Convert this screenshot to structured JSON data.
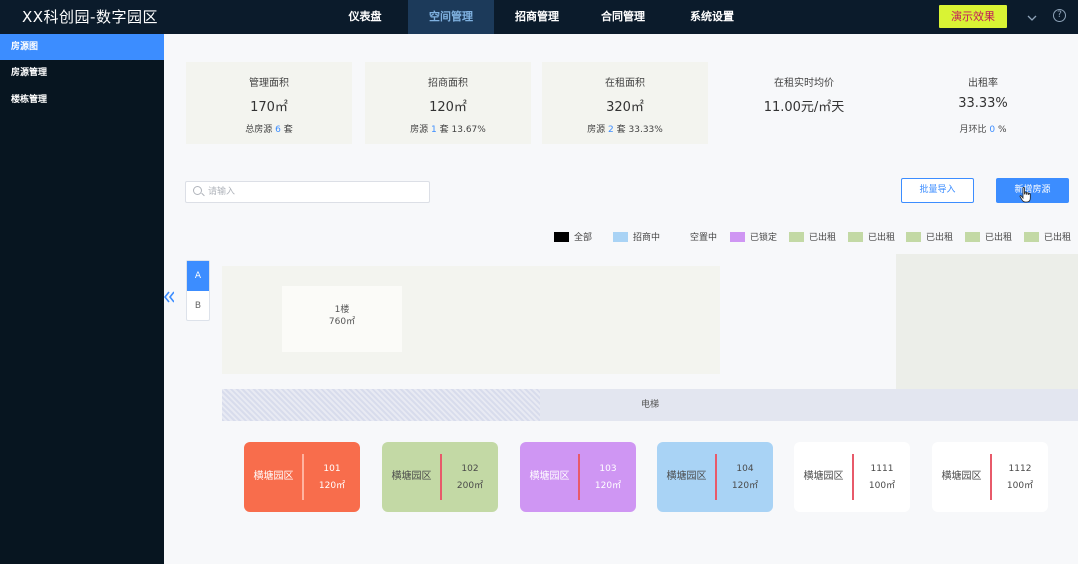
{
  "app": {
    "title": "XX科创园-数字园区"
  },
  "nav": {
    "items": [
      {
        "label": "仪表盘"
      },
      {
        "label": "空间管理"
      },
      {
        "label": "招商管理"
      },
      {
        "label": "合同管理"
      },
      {
        "label": "系统设置"
      }
    ],
    "active_index": 1
  },
  "header": {
    "demo_label": "演示效果",
    "chevron_icon": "chevron-down-icon",
    "help_icon": "help-icon",
    "help_glyph": "?"
  },
  "sidebar": {
    "items": [
      {
        "label": "房源图"
      },
      {
        "label": "房源管理"
      },
      {
        "label": "楼栋管理"
      }
    ],
    "active_index": 0
  },
  "stats": [
    {
      "label": "管理面积",
      "value": "170㎡",
      "sub_prefix": "总房源",
      "sub_num": "6",
      "sub_suffix": "套"
    },
    {
      "label": "招商面积",
      "value": "120㎡",
      "sub_prefix": "房源",
      "sub_num": "1",
      "sub_suffix": "套 13.67%"
    },
    {
      "label": "在租面积",
      "value": "320㎡",
      "sub_prefix": "房源",
      "sub_num": "2",
      "sub_suffix": "套 33.33%"
    },
    {
      "label": "在租实时均价",
      "value": "11.00元/㎡天"
    },
    {
      "label": "出租率",
      "value": "33.33%",
      "sub_prefix": "月环比",
      "sub_num": "0",
      "sub_suffix": "%"
    }
  ],
  "search": {
    "placeholder": "请输入",
    "value": ""
  },
  "actions": {
    "import_label": "批量导入",
    "new_label": "新增房源"
  },
  "legend": [
    {
      "label": "全部",
      "color": "#000000"
    },
    {
      "label": "招商中",
      "color": "#a9d3f5"
    },
    {
      "label": "空置中",
      "color": ""
    },
    {
      "label": "已锁定",
      "color": "#cf96f3"
    },
    {
      "label": "已出租",
      "color": "#c3d9a5"
    },
    {
      "label": "已出租",
      "color": "#c3d9a5"
    },
    {
      "label": "已出租",
      "color": "#c3d9a5"
    },
    {
      "label": "已出租",
      "color": "#c3d9a5"
    },
    {
      "label": "已出租",
      "color": "#c3d9a5"
    }
  ],
  "buildings": [
    {
      "label": "A"
    },
    {
      "label": "B"
    }
  ],
  "active_building": 0,
  "floor": {
    "name": "1楼",
    "area": "760㎡"
  },
  "elevator": {
    "label": "电梯"
  },
  "rooms": [
    {
      "park": "横塘园区",
      "number": "101",
      "area": "120㎡",
      "bg": "#f86d4c",
      "text_color": "#ffffff",
      "bar_color": "#ffb3a0"
    },
    {
      "park": "横塘园区",
      "number": "102",
      "area": "200㎡",
      "bg": "#c3d9a5",
      "text_color": "#4a4a4a",
      "bar_color": "#e85a6a"
    },
    {
      "park": "横塘园区",
      "number": "103",
      "area": "120㎡",
      "bg": "#cf96f3",
      "text_color": "#ffffff",
      "bar_color": "#e85a6a"
    },
    {
      "park": "横塘园区",
      "number": "104",
      "area": "120㎡",
      "bg": "#a9d3f5",
      "text_color": "#4a4a4a",
      "bar_color": "#e85a6a"
    },
    {
      "park": "横塘园区",
      "number": "1111",
      "area": "100㎡",
      "bg": "#ffffff",
      "text_color": "#4a4a4a",
      "bar_color": "#e85a6a"
    },
    {
      "park": "横塘园区",
      "number": "1112",
      "area": "100㎡",
      "bg": "#ffffff",
      "text_color": "#4a4a4a",
      "bar_color": "#e85a6a"
    }
  ]
}
